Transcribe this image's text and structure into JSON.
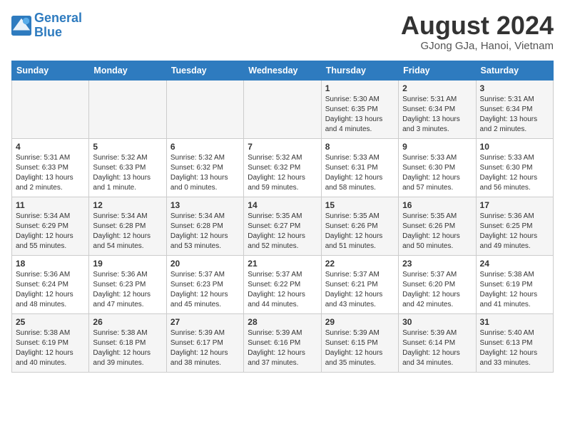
{
  "header": {
    "logo_line1": "General",
    "logo_line2": "Blue",
    "month_year": "August 2024",
    "location": "GJong GJa, Hanoi, Vietnam"
  },
  "weekdays": [
    "Sunday",
    "Monday",
    "Tuesday",
    "Wednesday",
    "Thursday",
    "Friday",
    "Saturday"
  ],
  "weeks": [
    [
      {
        "day": "",
        "info": ""
      },
      {
        "day": "",
        "info": ""
      },
      {
        "day": "",
        "info": ""
      },
      {
        "day": "",
        "info": ""
      },
      {
        "day": "1",
        "info": "Sunrise: 5:30 AM\nSunset: 6:35 PM\nDaylight: 13 hours and 4 minutes."
      },
      {
        "day": "2",
        "info": "Sunrise: 5:31 AM\nSunset: 6:34 PM\nDaylight: 13 hours and 3 minutes."
      },
      {
        "day": "3",
        "info": "Sunrise: 5:31 AM\nSunset: 6:34 PM\nDaylight: 13 hours and 2 minutes."
      }
    ],
    [
      {
        "day": "4",
        "info": "Sunrise: 5:31 AM\nSunset: 6:33 PM\nDaylight: 13 hours and 2 minutes."
      },
      {
        "day": "5",
        "info": "Sunrise: 5:32 AM\nSunset: 6:33 PM\nDaylight: 13 hours and 1 minute."
      },
      {
        "day": "6",
        "info": "Sunrise: 5:32 AM\nSunset: 6:32 PM\nDaylight: 13 hours and 0 minutes."
      },
      {
        "day": "7",
        "info": "Sunrise: 5:32 AM\nSunset: 6:32 PM\nDaylight: 12 hours and 59 minutes."
      },
      {
        "day": "8",
        "info": "Sunrise: 5:33 AM\nSunset: 6:31 PM\nDaylight: 12 hours and 58 minutes."
      },
      {
        "day": "9",
        "info": "Sunrise: 5:33 AM\nSunset: 6:30 PM\nDaylight: 12 hours and 57 minutes."
      },
      {
        "day": "10",
        "info": "Sunrise: 5:33 AM\nSunset: 6:30 PM\nDaylight: 12 hours and 56 minutes."
      }
    ],
    [
      {
        "day": "11",
        "info": "Sunrise: 5:34 AM\nSunset: 6:29 PM\nDaylight: 12 hours and 55 minutes."
      },
      {
        "day": "12",
        "info": "Sunrise: 5:34 AM\nSunset: 6:28 PM\nDaylight: 12 hours and 54 minutes."
      },
      {
        "day": "13",
        "info": "Sunrise: 5:34 AM\nSunset: 6:28 PM\nDaylight: 12 hours and 53 minutes."
      },
      {
        "day": "14",
        "info": "Sunrise: 5:35 AM\nSunset: 6:27 PM\nDaylight: 12 hours and 52 minutes."
      },
      {
        "day": "15",
        "info": "Sunrise: 5:35 AM\nSunset: 6:26 PM\nDaylight: 12 hours and 51 minutes."
      },
      {
        "day": "16",
        "info": "Sunrise: 5:35 AM\nSunset: 6:26 PM\nDaylight: 12 hours and 50 minutes."
      },
      {
        "day": "17",
        "info": "Sunrise: 5:36 AM\nSunset: 6:25 PM\nDaylight: 12 hours and 49 minutes."
      }
    ],
    [
      {
        "day": "18",
        "info": "Sunrise: 5:36 AM\nSunset: 6:24 PM\nDaylight: 12 hours and 48 minutes."
      },
      {
        "day": "19",
        "info": "Sunrise: 5:36 AM\nSunset: 6:23 PM\nDaylight: 12 hours and 47 minutes."
      },
      {
        "day": "20",
        "info": "Sunrise: 5:37 AM\nSunset: 6:23 PM\nDaylight: 12 hours and 45 minutes."
      },
      {
        "day": "21",
        "info": "Sunrise: 5:37 AM\nSunset: 6:22 PM\nDaylight: 12 hours and 44 minutes."
      },
      {
        "day": "22",
        "info": "Sunrise: 5:37 AM\nSunset: 6:21 PM\nDaylight: 12 hours and 43 minutes."
      },
      {
        "day": "23",
        "info": "Sunrise: 5:37 AM\nSunset: 6:20 PM\nDaylight: 12 hours and 42 minutes."
      },
      {
        "day": "24",
        "info": "Sunrise: 5:38 AM\nSunset: 6:19 PM\nDaylight: 12 hours and 41 minutes."
      }
    ],
    [
      {
        "day": "25",
        "info": "Sunrise: 5:38 AM\nSunset: 6:19 PM\nDaylight: 12 hours and 40 minutes."
      },
      {
        "day": "26",
        "info": "Sunrise: 5:38 AM\nSunset: 6:18 PM\nDaylight: 12 hours and 39 minutes."
      },
      {
        "day": "27",
        "info": "Sunrise: 5:39 AM\nSunset: 6:17 PM\nDaylight: 12 hours and 38 minutes."
      },
      {
        "day": "28",
        "info": "Sunrise: 5:39 AM\nSunset: 6:16 PM\nDaylight: 12 hours and 37 minutes."
      },
      {
        "day": "29",
        "info": "Sunrise: 5:39 AM\nSunset: 6:15 PM\nDaylight: 12 hours and 35 minutes."
      },
      {
        "day": "30",
        "info": "Sunrise: 5:39 AM\nSunset: 6:14 PM\nDaylight: 12 hours and 34 minutes."
      },
      {
        "day": "31",
        "info": "Sunrise: 5:40 AM\nSunset: 6:13 PM\nDaylight: 12 hours and 33 minutes."
      }
    ]
  ]
}
